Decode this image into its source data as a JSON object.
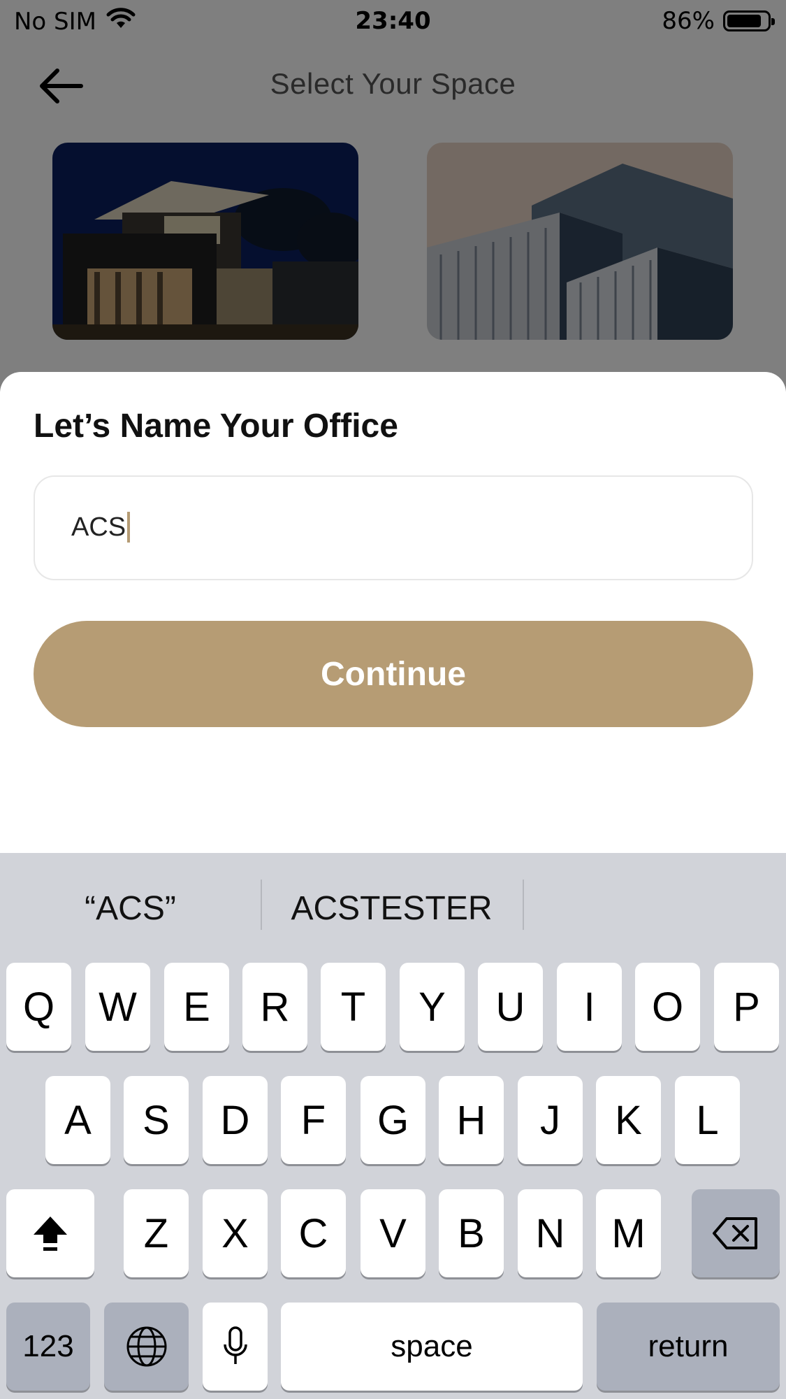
{
  "status_bar": {
    "carrier": "No SIM",
    "time": "23:40",
    "battery": "86%"
  },
  "header": {
    "title": "Select Your Space"
  },
  "sheet": {
    "title": "Let’s Name Your Office",
    "input_value": "ACS",
    "continue_label": "Continue"
  },
  "colors": {
    "accent": "#b69c74"
  },
  "keyboard": {
    "suggestions": [
      "“ACS”",
      "ACSTESTER"
    ],
    "row1": [
      "Q",
      "W",
      "E",
      "R",
      "T",
      "Y",
      "U",
      "I",
      "O",
      "P"
    ],
    "row2": [
      "A",
      "S",
      "D",
      "F",
      "G",
      "H",
      "J",
      "K",
      "L"
    ],
    "row3": [
      "Z",
      "X",
      "C",
      "V",
      "B",
      "N",
      "M"
    ],
    "numbers_label": "123",
    "space_label": "space",
    "return_label": "return"
  }
}
